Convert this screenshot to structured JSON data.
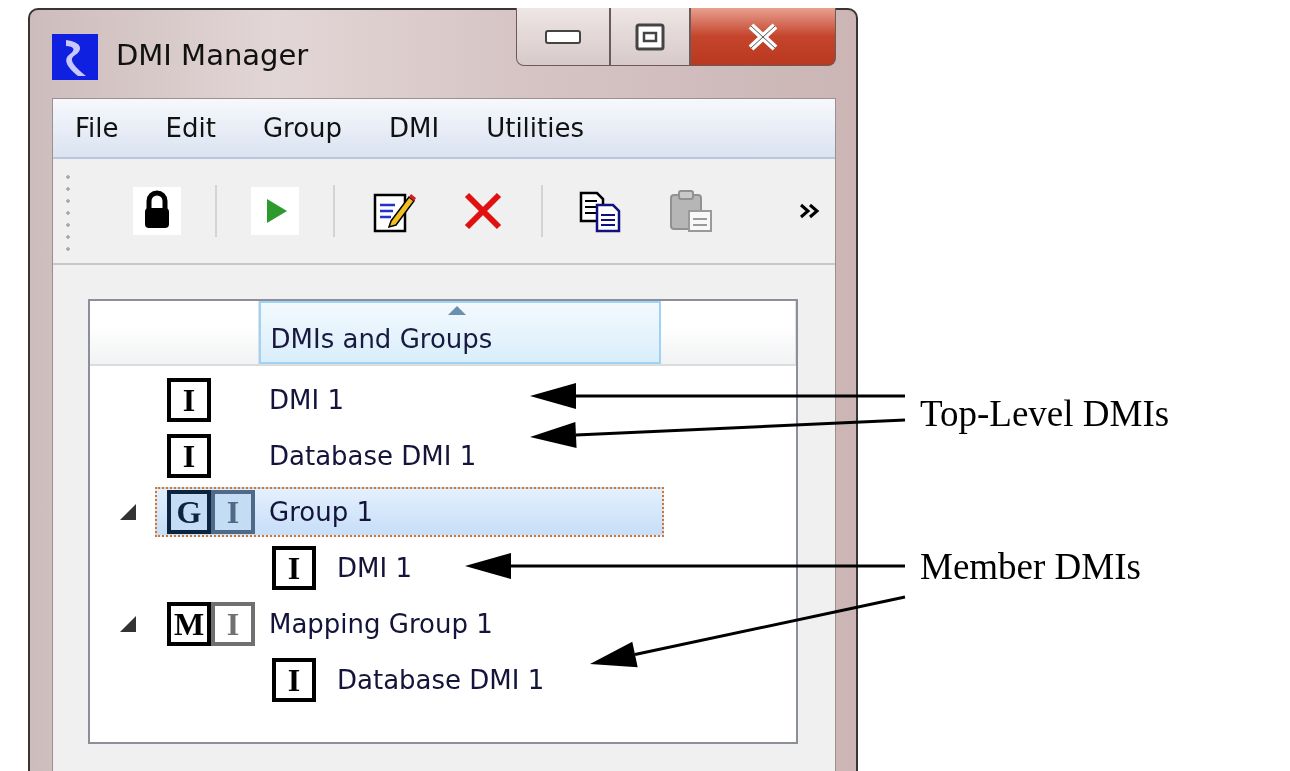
{
  "window": {
    "title": "DMI Manager"
  },
  "menu": [
    "File",
    "Edit",
    "Group",
    "DMI",
    "Utilities"
  ],
  "toolbar": {
    "groups": [
      {
        "buttons": [
          {
            "kind": "lock",
            "disabled": false
          }
        ]
      },
      {
        "buttons": [
          {
            "kind": "run",
            "disabled": false
          }
        ]
      },
      {
        "buttons": [
          {
            "kind": "edit",
            "disabled": false
          },
          {
            "kind": "delete",
            "disabled": false
          }
        ]
      },
      {
        "buttons": [
          {
            "kind": "copy",
            "disabled": false
          },
          {
            "kind": "paste",
            "disabled": true
          }
        ]
      }
    ]
  },
  "tree": {
    "columns": [
      {
        "label": "DMIs and Groups",
        "sorted": true
      }
    ],
    "items": [
      {
        "label": "DMI 1",
        "selected": false,
        "badges": [
          {
            "letter": "I",
            "dim": false
          }
        ]
      },
      {
        "label": "Database DMI 1",
        "selected": false,
        "badges": [
          {
            "letter": "I",
            "dim": false
          }
        ]
      },
      {
        "label": "Group 1",
        "selected": true,
        "expanded": true,
        "badges": [
          {
            "letter": "G",
            "dim": false
          },
          {
            "letter": "I",
            "dim": true
          }
        ],
        "children": [
          {
            "label": "DMI 1",
            "selected": false,
            "badges": [
              {
                "letter": "I",
                "dim": false
              }
            ]
          }
        ]
      },
      {
        "label": "Mapping Group 1",
        "selected": false,
        "expanded": true,
        "badges": [
          {
            "letter": "M",
            "dim": false
          },
          {
            "letter": "I",
            "dim": true
          }
        ],
        "children": [
          {
            "label": "Database DMI 1",
            "selected": false,
            "badges": [
              {
                "letter": "I",
                "dim": false
              }
            ]
          }
        ]
      }
    ]
  },
  "annotations": [
    {
      "label": "Top-Level DMIs"
    },
    {
      "label": "Member DMIs"
    }
  ]
}
